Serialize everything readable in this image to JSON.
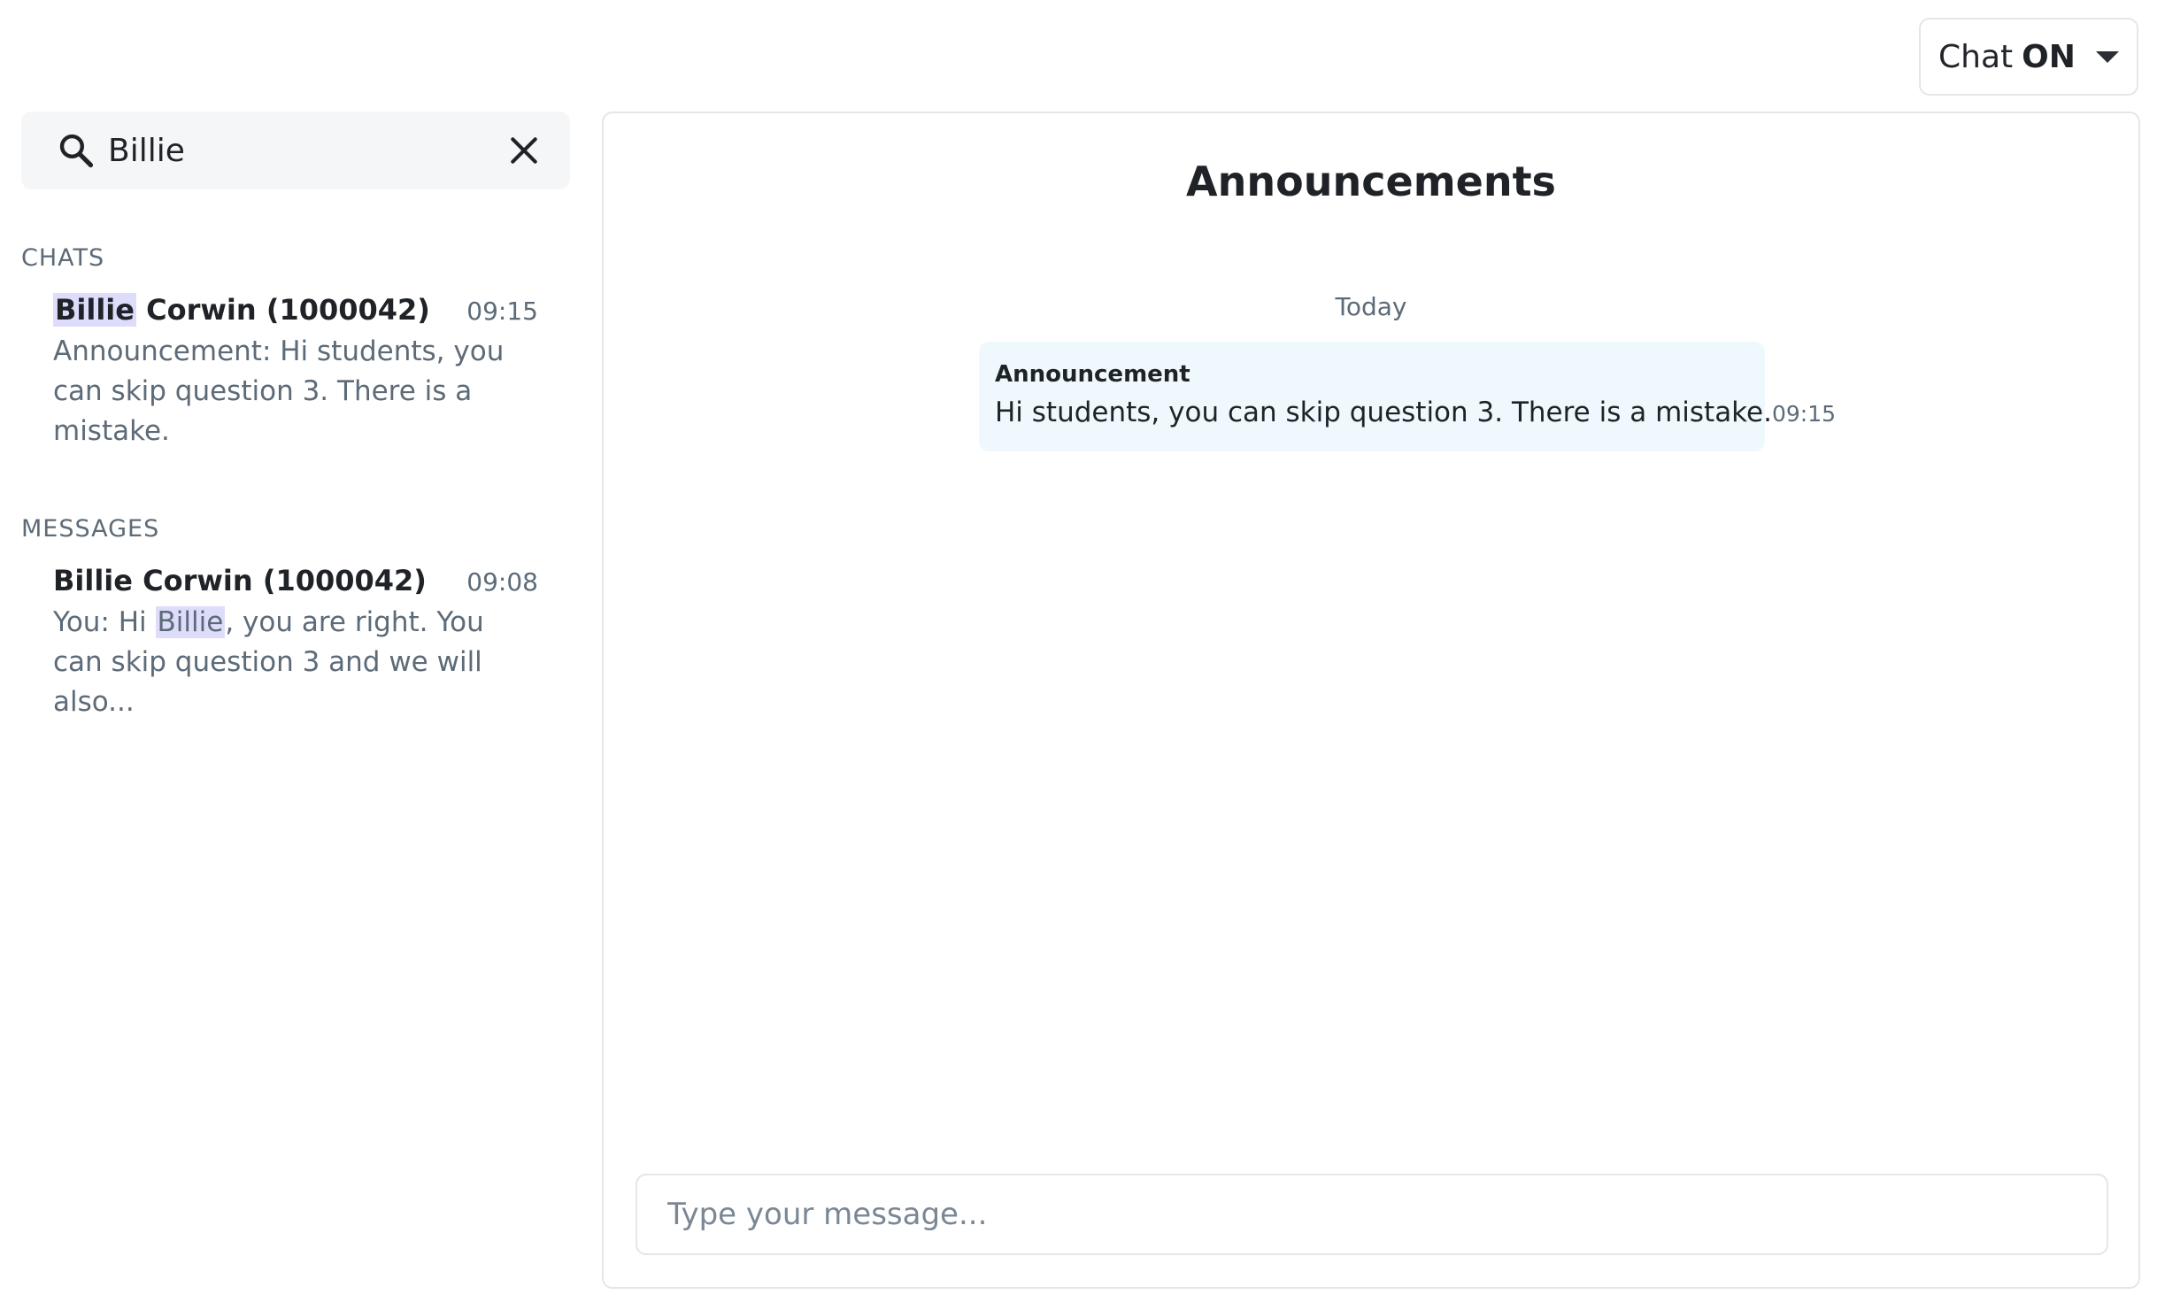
{
  "chat_toggle": {
    "label": "Chat",
    "state": "ON",
    "icon": "caret-down-icon"
  },
  "search": {
    "value": "Billie",
    "search_icon": "search-icon",
    "clear_icon": "close-icon"
  },
  "sections": {
    "chats": {
      "title": "CHATS",
      "items": [
        {
          "name_highlight": "Billie",
          "name_rest": " Corwin (1000042)",
          "time": "09:15",
          "preview": "Announcement: Hi students, you can skip question 3. There is a mistake."
        }
      ]
    },
    "messages": {
      "title": "MESSAGES",
      "items": [
        {
          "name": "Billie Corwin (1000042)",
          "time": "09:08",
          "preview_before": "You: Hi ",
          "preview_highlight": "Billie",
          "preview_after": ", you are right. You can skip question 3 and we will also..."
        }
      ]
    }
  },
  "conversation": {
    "title": "Announcements",
    "day_label": "Today",
    "messages": [
      {
        "sender": "Announcement",
        "text": "Hi students, you can skip question 3. There is a mistake.",
        "time": "09:15"
      }
    ],
    "composer_placeholder": "Type your message..."
  },
  "colors": {
    "highlight": "#dedcfb",
    "bubble_background": "#eef8fd",
    "muted_text": "#5d6b78",
    "border": "#e3e6ea"
  }
}
